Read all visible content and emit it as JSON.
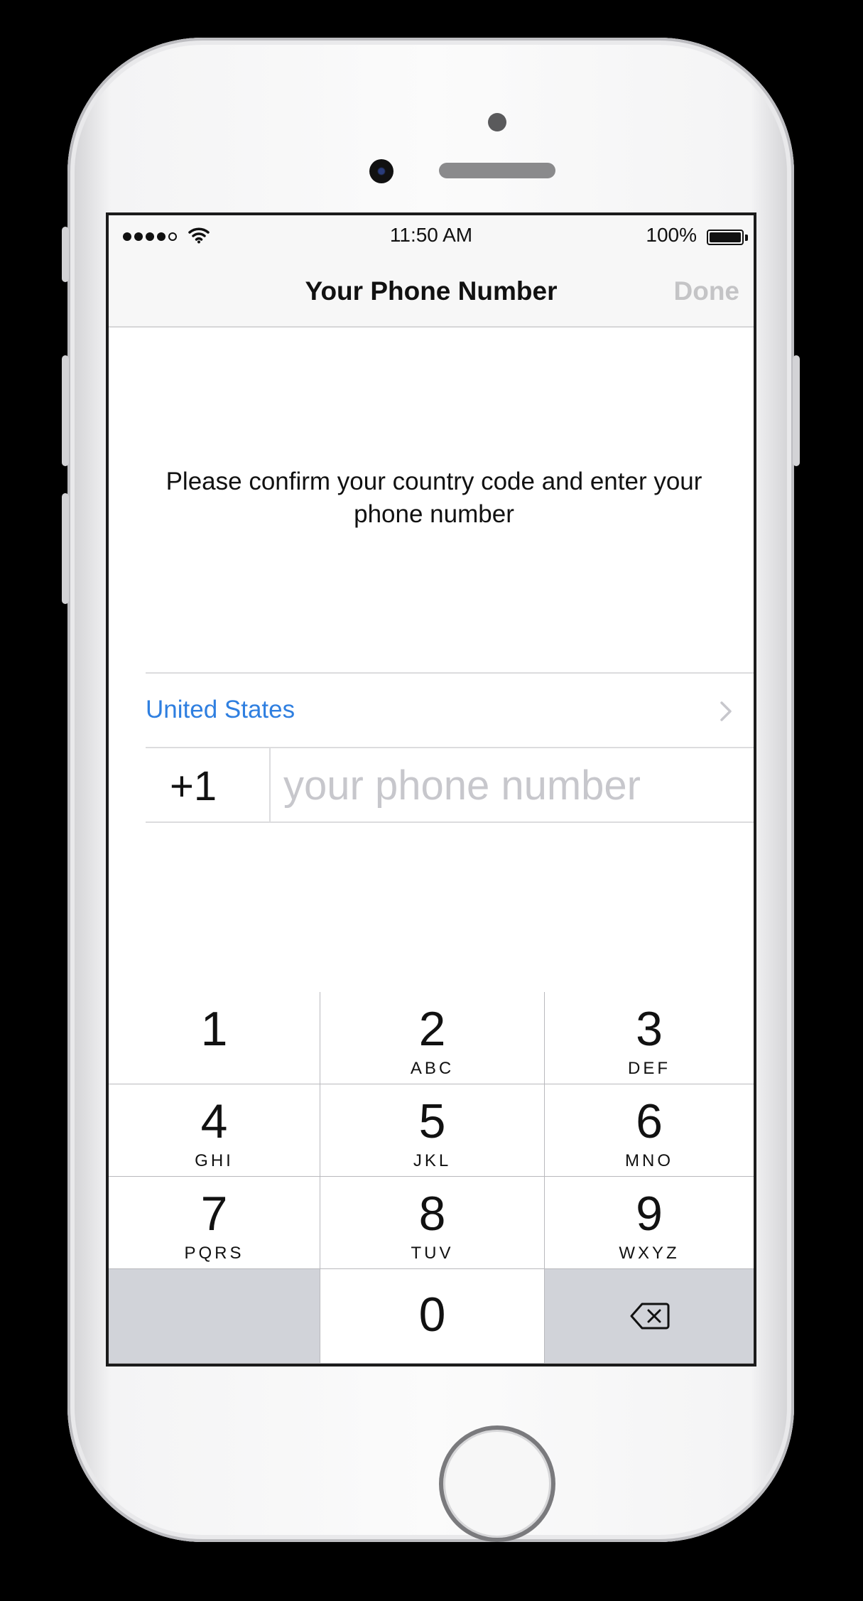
{
  "status_bar": {
    "time": "11:50 AM",
    "battery_percent": "100%",
    "signal_bars": 4,
    "signal_total": 5,
    "icons": [
      "signal-dots-icon",
      "wifi-icon",
      "battery-icon"
    ]
  },
  "nav": {
    "title": "Your Phone Number",
    "done_label": "Done"
  },
  "prompt": "Please confirm your country code and enter your phone number",
  "country": {
    "name": "United States",
    "icon": "chevron-right-icon"
  },
  "phone": {
    "code": "+1",
    "value": "",
    "placeholder": "your phone number"
  },
  "keypad": {
    "keys": [
      {
        "num": "1",
        "letters": ""
      },
      {
        "num": "2",
        "letters": "ABC"
      },
      {
        "num": "3",
        "letters": "DEF"
      },
      {
        "num": "4",
        "letters": "GHI"
      },
      {
        "num": "5",
        "letters": "JKL"
      },
      {
        "num": "6",
        "letters": "MNO"
      },
      {
        "num": "7",
        "letters": "PQRS"
      },
      {
        "num": "8",
        "letters": "TUV"
      },
      {
        "num": "9",
        "letters": "WXYZ"
      },
      {
        "num": "0",
        "letters": ""
      }
    ],
    "delete_icon": "backspace-icon"
  },
  "colors": {
    "link": "#2f7fe0",
    "disabled": "#c4c4c6",
    "keypad_dark": "#d1d3d9"
  }
}
